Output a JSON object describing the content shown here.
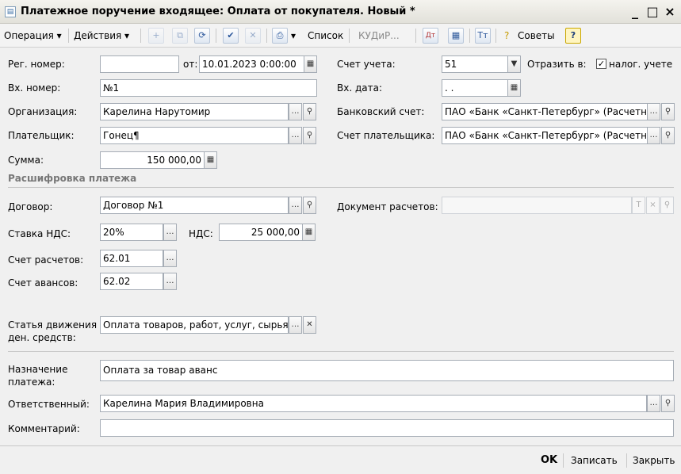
{
  "window": {
    "title": "Платежное поручение входящее: Оплата от покупателя. Новый *",
    "minimize": "_",
    "maximize": "□",
    "close": "×"
  },
  "toolbar": {
    "operation": "Операция ▾",
    "actions": "Действия ▾",
    "list": "Список",
    "kudir": "КУДиР...",
    "tips": "Советы",
    "help": "?"
  },
  "form": {
    "reg_number": {
      "label": "Рег. номер:",
      "value": ""
    },
    "from": {
      "label": "от:",
      "value": "10.01.2023  0:00:00"
    },
    "in_number": {
      "label": "Вх. номер:",
      "value": "№1"
    },
    "organization": {
      "label": "Организация:",
      "value": "Карелина Нарутомир"
    },
    "payer": {
      "label": "Плательщик:",
      "value": "Гонец¶"
    },
    "sum": {
      "label": "Сумма:",
      "value": "150 000,00"
    },
    "account": {
      "label": "Счет учета:",
      "value": "51"
    },
    "reflect_in": {
      "label": "Отразить в:",
      "option": "налог. учете",
      "checked": true
    },
    "in_date": {
      "label": "Вх. дата:",
      "value": " .  ."
    },
    "bank_account": {
      "label": "Банковский счет:",
      "value": "ПАО «Банк «Санкт-Петербург» (Расчетн"
    },
    "payer_account": {
      "label": "Счет плательщика:",
      "value": "ПАО «Банк «Санкт-Петербург» (Расчетн"
    },
    "section_title": "Расшифровка платежа",
    "contract": {
      "label": "Договор:",
      "value": "Договор №1"
    },
    "settlement_doc": {
      "label": "Документ расчетов:",
      "value": ""
    },
    "vat_rate": {
      "label": "Ставка НДС:",
      "value": "20%"
    },
    "vat": {
      "label": "НДС:",
      "value": "25 000,00"
    },
    "settlement_account": {
      "label": "Счет расчетов:",
      "value": "62.01"
    },
    "advance_account": {
      "label": "Счет авансов:",
      "value": "62.02"
    },
    "cash_flow_label_1": "Статья движения",
    "cash_flow_label_2": "ден. средств:",
    "cash_flow_value": "Оплата товаров, работ, услуг, сырья",
    "purpose_label_1": "Назначение",
    "purpose_label_2": "платежа:",
    "purpose_value": "Оплата за товар аванс",
    "responsible": {
      "label": "Ответственный:",
      "value": "Карелина Мария Владимировна"
    },
    "comment": {
      "label": "Комментарий:",
      "value": ""
    }
  },
  "footer": {
    "ok": "OK",
    "save": "Записать",
    "close": "Закрыть"
  }
}
